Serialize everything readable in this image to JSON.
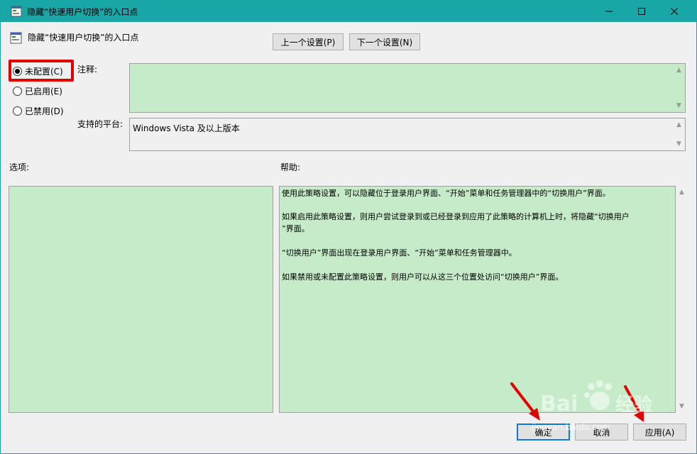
{
  "window": {
    "title": "隐藏“快速用户切换”的入口点",
    "minimize_icon": "minimize-icon",
    "maximize_icon": "maximize-icon",
    "close_icon": "close-icon"
  },
  "header": {
    "title": "隐藏“快速用户切换”的入口点",
    "icon": "policy-settings-icon"
  },
  "nav": {
    "prev_label": "上一个设置(P)",
    "next_label": "下一个设置(N)"
  },
  "state": {
    "options": [
      {
        "label": "未配置(C)",
        "selected": true
      },
      {
        "label": "已启用(E)",
        "selected": false
      },
      {
        "label": "已禁用(D)",
        "selected": false
      }
    ]
  },
  "fields": {
    "comment_label": "注释:",
    "comment_value": "",
    "platform_label": "支持的平台:",
    "platform_value": "Windows Vista 及以上版本",
    "options_label": "选项:",
    "help_label": "帮助:"
  },
  "help": {
    "paragraphs": [
      "使用此策略设置，可以隐藏位于登录用户界面、“开始”菜单和任务管理器中的“切换用户”界面。",
      "如果启用此策略设置，则用户尝试登录到或已经登录到应用了此策略的计算机上时，将隐藏“切换用户”界面。",
      "“切换用户”界面出现在登录用户界面、“开始”菜单和任务管理器中。",
      "如果禁用或未配置此策略设置，则用户可以从这三个位置处访问“切换用户”界面。"
    ],
    "para2_line1": "如果启用此策略设置，则用户尝试登录到或已经登录到应用了此策略的计算机上时，将隐藏“切换用户",
    "para2_line2": "”界面。"
  },
  "footer": {
    "ok_label": "确定",
    "cancel_label": "取消",
    "apply_label": "应用(A)"
  },
  "watermark": {
    "text": "Baidu 经验",
    "url": "jingyan.baidu.com"
  },
  "colors": {
    "titlebar": "#19a6a6",
    "field_green": "#c6ebc9",
    "highlight_red": "#e00000",
    "arrow_red": "#e00000"
  }
}
